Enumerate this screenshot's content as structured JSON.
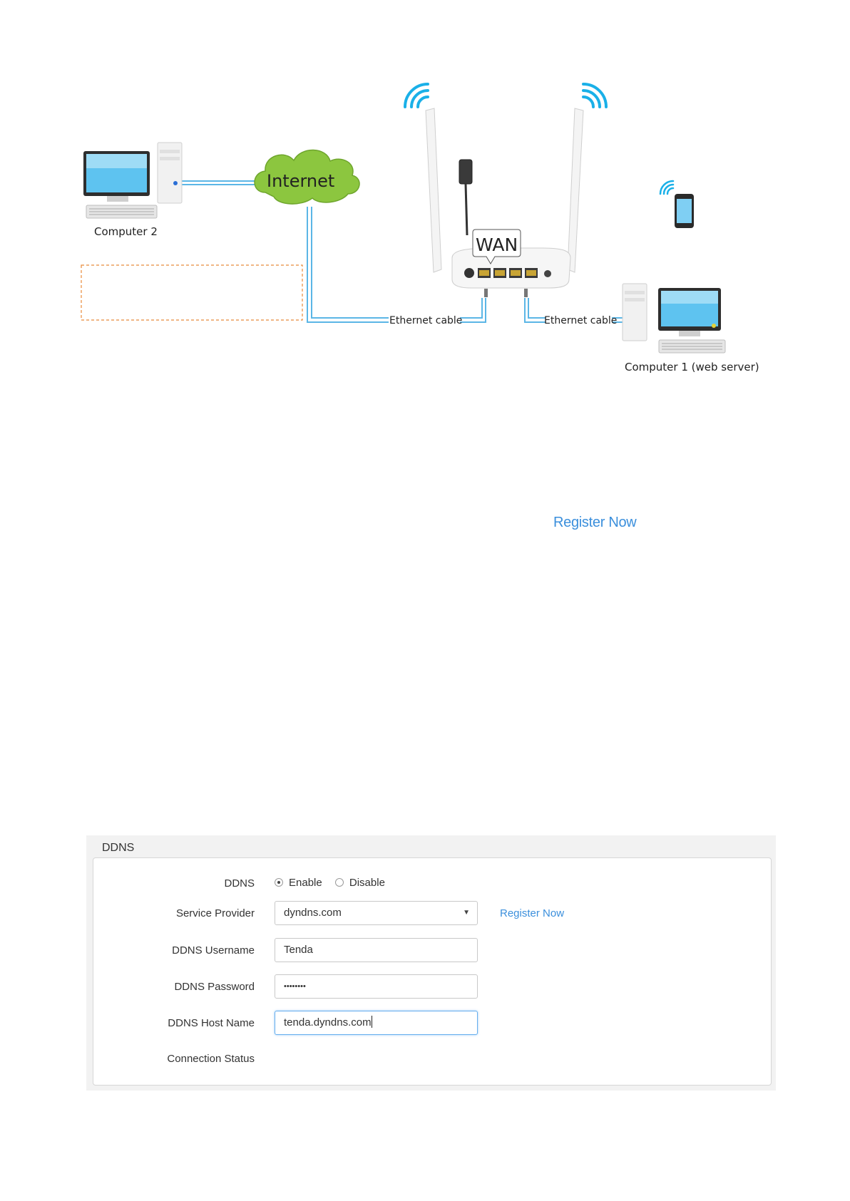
{
  "diagram": {
    "cloud_label": "Internet",
    "wan_label": "WAN",
    "computer2_label": "Computer 2",
    "computer1_label": "Computer 1 (web server)",
    "cable_left_label": "Ethernet cable",
    "cable_right_label": "Ethernet cable"
  },
  "top_register_link": "Register Now",
  "ddns": {
    "panel_title": "DDNS",
    "ddns_label": "DDNS",
    "enable_label": "Enable",
    "disable_label": "Disable",
    "selected": "Enable",
    "provider_label": "Service Provider",
    "provider_value": "dyndns.com",
    "register_link": "Register Now",
    "username_label": "DDNS Username",
    "username_value": "Tenda",
    "password_label": "DDNS Password",
    "password_value": "••••••••",
    "hostname_label": "DDNS Host Name",
    "hostname_value": "tenda.dyndns.com",
    "status_label": "Connection Status",
    "status_value": ""
  },
  "colors": {
    "link": "#3b8fdc",
    "wifi": "#1ab0e8",
    "cable": "#5bb6e6",
    "cloud": "#8cc63f",
    "dashed_box": "#e88a3a"
  }
}
